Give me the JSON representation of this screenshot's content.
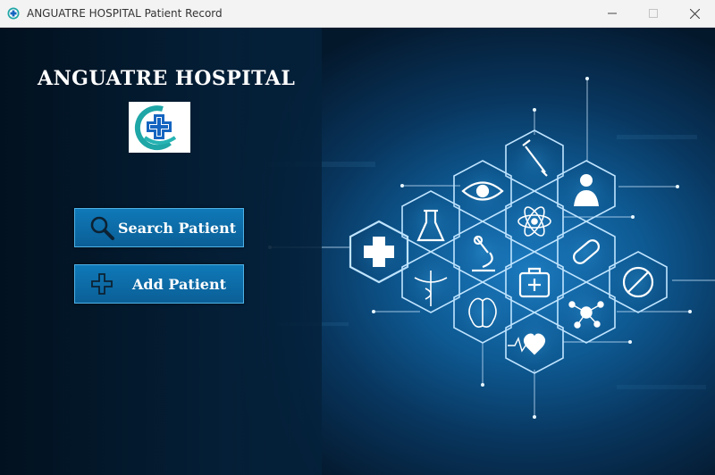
{
  "window": {
    "title": "ANGUATRE HOSPITAL Patient Record",
    "app_icon": "medical-cross-icon",
    "controls": [
      "minimize",
      "maximize",
      "close"
    ]
  },
  "main": {
    "hospital_name": "ANGUATRE HOSPITAL",
    "logo": "hospital-logo-icon",
    "buttons": {
      "search_label": "Search Patient",
      "search_icon": "magnifier-icon",
      "add_label": "Add Patient",
      "add_icon": "plus-icon"
    },
    "background_icons": [
      "syringe-icon",
      "doctor-icon",
      "eye-icon",
      "atom-icon",
      "flask-icon",
      "first-aid-cross-icon",
      "microscope-icon",
      "pill-icon",
      "caduceus-icon",
      "medical-kit-icon",
      "tablet-icon",
      "brain-icon",
      "molecule-icon",
      "heartbeat-icon"
    ]
  },
  "colors": {
    "button_fill": "#0b6aa6",
    "button_border": "#4fb2e6",
    "background_dark": "#04182c",
    "background_glow": "#1b7bc0",
    "logo_teal": "#1fa6a6",
    "logo_blue": "#1565c0"
  }
}
